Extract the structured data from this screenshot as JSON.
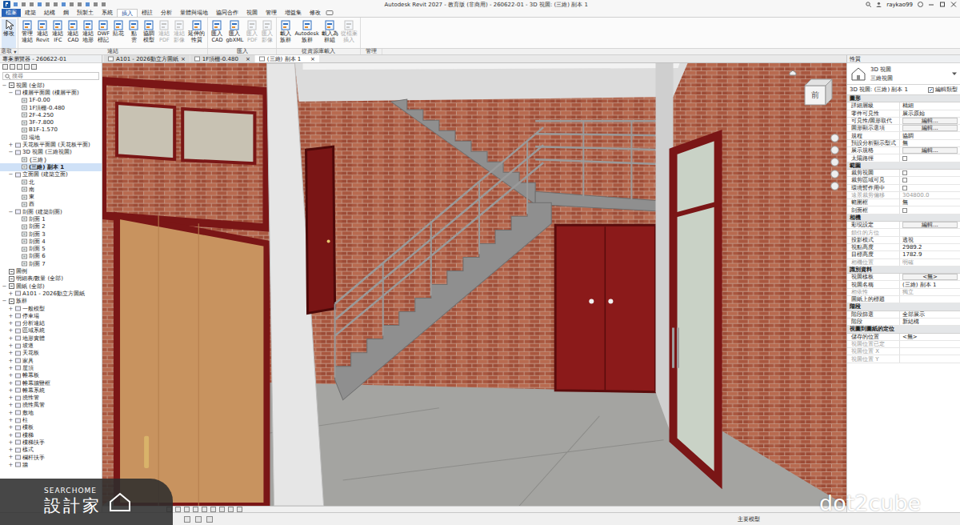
{
  "window": {
    "title": "Autodesk Revit 2027 - 教育版 (非商用) - 260622-01 - 3D 視圖: (三維) 副本 1",
    "user": "raykao99"
  },
  "ribbon": {
    "tabs": [
      {
        "label": "檔案",
        "selected": false,
        "kind": "file"
      },
      {
        "label": "建築",
        "selected": false,
        "kind": "tab"
      },
      {
        "label": "結構",
        "selected": false,
        "kind": "tab"
      },
      {
        "label": "鋼",
        "selected": false,
        "kind": "tab"
      },
      {
        "label": "預製土",
        "selected": false,
        "kind": "tab"
      },
      {
        "label": "系統",
        "selected": false,
        "kind": "tab"
      },
      {
        "label": "插入",
        "selected": true,
        "kind": "tab"
      },
      {
        "label": "標註",
        "selected": false,
        "kind": "tab"
      },
      {
        "label": "分析",
        "selected": false,
        "kind": "tab"
      },
      {
        "label": "量體與場地",
        "selected": false,
        "kind": "tab"
      },
      {
        "label": "協同合作",
        "selected": false,
        "kind": "tab"
      },
      {
        "label": "視圖",
        "selected": false,
        "kind": "tab"
      },
      {
        "label": "管理",
        "selected": false,
        "kind": "tab"
      },
      {
        "label": "增益集",
        "selected": false,
        "kind": "tab"
      },
      {
        "label": "修改",
        "selected": false,
        "kind": "tab"
      }
    ],
    "panels": [
      {
        "label": "選取",
        "dropdown": "▾",
        "buttons": [
          {
            "lines": [
              "修改"
            ],
            "disabled": false,
            "selected": true
          }
        ]
      },
      {
        "label": "連結",
        "dropdown": "",
        "buttons": [
          {
            "lines": [
              "管理",
              "連結"
            ],
            "disabled": false,
            "selected": false
          },
          {
            "lines": [
              "連結",
              "Revit"
            ],
            "disabled": false,
            "selected": false
          },
          {
            "lines": [
              "連結",
              "IFC"
            ],
            "disabled": false,
            "selected": false
          },
          {
            "lines": [
              "連結",
              "CAD"
            ],
            "disabled": false,
            "selected": false
          },
          {
            "lines": [
              "連結",
              "地形"
            ],
            "disabled": false,
            "selected": false
          },
          {
            "lines": [
              "DWF",
              "標記"
            ],
            "disabled": false,
            "selected": false
          },
          {
            "lines": [
              "貼花"
            ],
            "disabled": false,
            "selected": false
          },
          {
            "lines": [
              "點",
              "雲"
            ],
            "disabled": false,
            "selected": false
          },
          {
            "lines": [
              "協調",
              "模型"
            ],
            "disabled": false,
            "selected": false
          },
          {
            "lines": [
              "連結",
              "PDF"
            ],
            "disabled": true,
            "selected": false
          },
          {
            "lines": [
              "連結",
              "影像"
            ],
            "disabled": true,
            "selected": false
          },
          {
            "lines": [
              "延伸的",
              "性質"
            ],
            "disabled": false,
            "selected": false
          }
        ]
      },
      {
        "label": "匯入",
        "dropdown": "",
        "buttons": [
          {
            "lines": [
              "匯入",
              "CAD"
            ],
            "disabled": false,
            "selected": false
          },
          {
            "lines": [
              "匯入",
              "gbXML"
            ],
            "disabled": false,
            "selected": false
          },
          {
            "lines": [
              "匯入",
              "PDF"
            ],
            "disabled": true,
            "selected": false
          },
          {
            "lines": [
              "匯入",
              "影像"
            ],
            "disabled": true,
            "selected": false
          }
        ]
      },
      {
        "label": "從資源庫載入",
        "dropdown": "",
        "buttons": [
          {
            "lines": [
              "載入",
              "族群"
            ],
            "disabled": false,
            "selected": false
          },
          {
            "lines": [
              "Autodesk",
              "族群"
            ],
            "disabled": false,
            "selected": false
          },
          {
            "lines": [
              "載入為",
              "群組"
            ],
            "disabled": false,
            "selected": false
          },
          {
            "lines": [
              "從檔案",
              "插入"
            ],
            "disabled": true,
            "selected": false
          }
        ]
      }
    ],
    "bottom_label": "管理"
  },
  "browser": {
    "title": "專案瀏覽器 - 260622-01",
    "search": {
      "placeholder": "搜尋"
    },
    "items": [
      {
        "label": "視圖 (全部)",
        "level": 0,
        "toggle": "−",
        "selected": false
      },
      {
        "label": "樓層平面圖 (樓層平面)",
        "level": 1,
        "toggle": "−",
        "selected": false
      },
      {
        "label": "1F-0.00",
        "level": 2,
        "toggle": "",
        "selected": false
      },
      {
        "label": "1F頂棚-0.480",
        "level": 2,
        "toggle": "",
        "selected": false
      },
      {
        "label": "2F-4.250",
        "level": 2,
        "toggle": "",
        "selected": false
      },
      {
        "label": "3F-7.800",
        "level": 2,
        "toggle": "",
        "selected": false
      },
      {
        "label": "B1F-1.570",
        "level": 2,
        "toggle": "",
        "selected": false
      },
      {
        "label": "場地",
        "level": 2,
        "toggle": "",
        "selected": false
      },
      {
        "label": "天花板平面圖 (天花板平面)",
        "level": 1,
        "toggle": "+",
        "selected": false
      },
      {
        "label": "3D 視圖 (三維視圖)",
        "level": 1,
        "toggle": "−",
        "selected": false
      },
      {
        "label": "{三維}",
        "level": 2,
        "toggle": "",
        "selected": false
      },
      {
        "label": "(三維) 副本 1",
        "level": 2,
        "toggle": "",
        "selected": true
      },
      {
        "label": "立面圖 (建築立面)",
        "level": 1,
        "toggle": "−",
        "selected": false
      },
      {
        "label": "北",
        "level": 2,
        "toggle": "",
        "selected": false
      },
      {
        "label": "南",
        "level": 2,
        "toggle": "",
        "selected": false
      },
      {
        "label": "東",
        "level": 2,
        "toggle": "",
        "selected": false
      },
      {
        "label": "西",
        "level": 2,
        "toggle": "",
        "selected": false
      },
      {
        "label": "剖面 (建築剖面)",
        "level": 1,
        "toggle": "−",
        "selected": false
      },
      {
        "label": "剖面 1",
        "level": 2,
        "toggle": "",
        "selected": false
      },
      {
        "label": "剖面 2",
        "level": 2,
        "toggle": "",
        "selected": false
      },
      {
        "label": "剖面 3",
        "level": 2,
        "toggle": "",
        "selected": false
      },
      {
        "label": "剖面 4",
        "level": 2,
        "toggle": "",
        "selected": false
      },
      {
        "label": "剖面 5",
        "level": 2,
        "toggle": "",
        "selected": false
      },
      {
        "label": "剖面 6",
        "level": 2,
        "toggle": "",
        "selected": false
      },
      {
        "label": "剖面 7",
        "level": 2,
        "toggle": "",
        "selected": false
      },
      {
        "label": "圖例",
        "level": 0,
        "toggle": "",
        "selected": false
      },
      {
        "label": "明細表/數量 (全部)",
        "level": 0,
        "toggle": "",
        "selected": false
      },
      {
        "label": "圖紙 (全部)",
        "level": 0,
        "toggle": "−",
        "selected": false
      },
      {
        "label": "A101 - 2026動立方圖紙",
        "level": 1,
        "toggle": "+",
        "selected": false
      },
      {
        "label": "族群",
        "level": 0,
        "toggle": "−",
        "selected": false
      },
      {
        "label": "一般模型",
        "level": 1,
        "toggle": "+",
        "selected": false
      },
      {
        "label": "停車場",
        "level": 1,
        "toggle": "+",
        "selected": false
      },
      {
        "label": "分析連結",
        "level": 1,
        "toggle": "+",
        "selected": false
      },
      {
        "label": "區域系統",
        "level": 1,
        "toggle": "+",
        "selected": false
      },
      {
        "label": "地形實體",
        "level": 1,
        "toggle": "+",
        "selected": false
      },
      {
        "label": "坡道",
        "level": 1,
        "toggle": "+",
        "selected": false
      },
      {
        "label": "天花板",
        "level": 1,
        "toggle": "+",
        "selected": false
      },
      {
        "label": "家具",
        "level": 1,
        "toggle": "+",
        "selected": false
      },
      {
        "label": "屋頂",
        "level": 1,
        "toggle": "+",
        "selected": false
      },
      {
        "label": "帷幕板",
        "level": 1,
        "toggle": "+",
        "selected": false
      },
      {
        "label": "帷幕牆豎框",
        "level": 1,
        "toggle": "+",
        "selected": false
      },
      {
        "label": "帷幕系統",
        "level": 1,
        "toggle": "+",
        "selected": false
      },
      {
        "label": "撓性管",
        "level": 1,
        "toggle": "+",
        "selected": false
      },
      {
        "label": "撓性風管",
        "level": 1,
        "toggle": "+",
        "selected": false
      },
      {
        "label": "敷地",
        "level": 1,
        "toggle": "+",
        "selected": false
      },
      {
        "label": "柱",
        "level": 1,
        "toggle": "+",
        "selected": false
      },
      {
        "label": "樓板",
        "level": 1,
        "toggle": "+",
        "selected": false
      },
      {
        "label": "樓梯",
        "level": 1,
        "toggle": "+",
        "selected": false
      },
      {
        "label": "樓梯扶手",
        "level": 1,
        "toggle": "+",
        "selected": false
      },
      {
        "label": "樣式",
        "level": 1,
        "toggle": "+",
        "selected": false
      },
      {
        "label": "欄杆扶手",
        "level": 1,
        "toggle": "+",
        "selected": false
      },
      {
        "label": "牆",
        "level": 1,
        "toggle": "+",
        "selected": false
      }
    ]
  },
  "view_tabs": [
    {
      "label": "A101 - 2026動立方圖紙",
      "close": "×",
      "selected": false
    },
    {
      "label": "1F頂棚-0.480",
      "close": "×",
      "selected": false
    },
    {
      "label": "(三維) 副本 1",
      "close": "×",
      "selected": true
    }
  ],
  "viewport": {
    "viewcube": "前"
  },
  "properties": {
    "title": "性質",
    "type_name": "3D 視圖",
    "type_sub": "三維視圖",
    "selector": "3D 視圖: (三維) 副本 1",
    "edit_type": "編輯類型",
    "sections": [
      {
        "title": "圖形",
        "rows": [
          {
            "label": "詳細層級",
            "value": "精細",
            "kind": "text",
            "disabled": false
          },
          {
            "label": "零件可見性",
            "value": "展示原始",
            "kind": "text",
            "disabled": false
          },
          {
            "label": "可見性/圖形取代",
            "value": "編輯...",
            "kind": "button",
            "disabled": false
          },
          {
            "label": "圖形顯示選項",
            "value": "編輯...",
            "kind": "button",
            "disabled": false
          },
          {
            "label": "規程",
            "value": "協調",
            "kind": "text",
            "disabled": false
          },
          {
            "label": "預設分析顯示型式",
            "value": "無",
            "kind": "text",
            "disabled": false
          },
          {
            "label": "展示規格",
            "value": "編輯...",
            "kind": "button",
            "disabled": false
          },
          {
            "label": "太陽路徑",
            "kind": "checkbox",
            "checked": false,
            "disabled": false
          }
        ]
      },
      {
        "title": "範圍",
        "rows": [
          {
            "label": "裁剪視圖",
            "kind": "checkbox",
            "checked": false,
            "disabled": false
          },
          {
            "label": "裁剪區域可見",
            "kind": "checkbox",
            "checked": false,
            "disabled": false
          },
          {
            "label": "環境暫作用中",
            "kind": "checkbox",
            "checked": false,
            "disabled": false
          },
          {
            "label": "遠景裁剪偏移",
            "value": "304800.0",
            "kind": "text",
            "disabled": true
          },
          {
            "label": "範圍框",
            "value": "無",
            "kind": "text",
            "disabled": false
          },
          {
            "label": "剖面框",
            "kind": "checkbox",
            "checked": false,
            "disabled": false
          }
        ]
      },
      {
        "title": "相機",
        "rows": [
          {
            "label": "彩現設定",
            "value": "編輯...",
            "kind": "button",
            "disabled": false
          },
          {
            "label": "鎖住的方位",
            "value": "",
            "kind": "text",
            "disabled": true
          },
          {
            "label": "投影模式",
            "value": "透視",
            "kind": "text",
            "disabled": false
          },
          {
            "label": "視點高度",
            "value": "2989.2",
            "kind": "text",
            "disabled": false
          },
          {
            "label": "目標高度",
            "value": "1782.9",
            "kind": "text",
            "disabled": false
          },
          {
            "label": "相機位置",
            "value": "明確",
            "kind": "text",
            "disabled": true
          }
        ]
      },
      {
        "title": "識別資料",
        "rows": [
          {
            "label": "視圖樣板",
            "value": "<無>",
            "kind": "button",
            "disabled": false
          },
          {
            "label": "視圖名稱",
            "value": "(三維) 副本 1",
            "kind": "text",
            "disabled": false
          },
          {
            "label": "相依性",
            "value": "獨立",
            "kind": "text",
            "disabled": true
          },
          {
            "label": "圖紙上的標題",
            "value": "",
            "kind": "text",
            "disabled": false
          }
        ]
      },
      {
        "title": "階段",
        "rows": [
          {
            "label": "階段篩選",
            "value": "全部展示",
            "kind": "text",
            "disabled": false
          },
          {
            "label": "階段",
            "value": "新結構",
            "kind": "text",
            "disabled": false
          }
        ]
      },
      {
        "title": "視圖到圖紙的定位",
        "rows": [
          {
            "label": "儲存的位置",
            "value": "<無>",
            "kind": "text",
            "disabled": false
          },
          {
            "label": "視圖位置已定",
            "value": "",
            "kind": "text",
            "disabled": true
          },
          {
            "label": "視圖位置 X",
            "value": "",
            "kind": "text",
            "disabled": true
          },
          {
            "label": "視圖位置 Y",
            "value": "",
            "kind": "text",
            "disabled": true
          }
        ]
      }
    ]
  },
  "status_bar": {
    "text": "主要模型"
  },
  "watermarks": {
    "brand_small": "SEARCHOME",
    "brand_big": "設計家",
    "right": "dot2cube"
  }
}
